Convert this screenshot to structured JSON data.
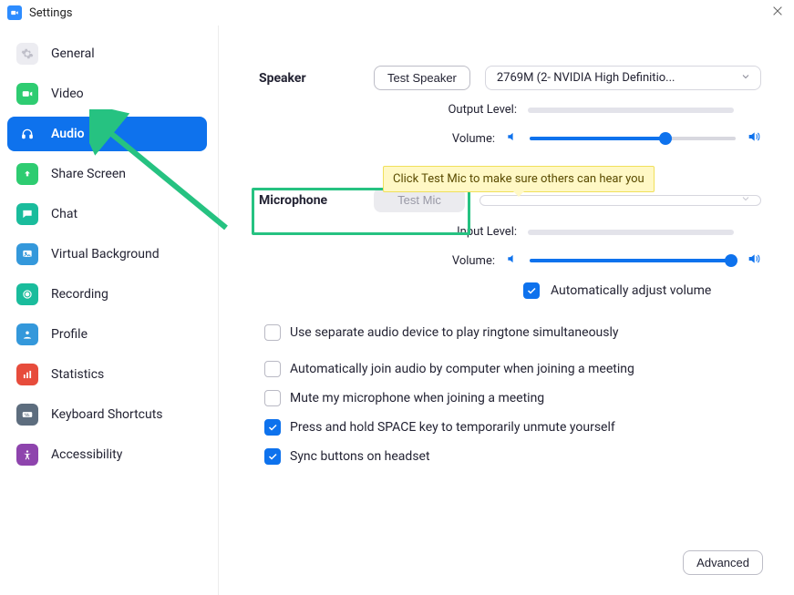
{
  "window": {
    "title": "Settings"
  },
  "sidebar": {
    "items": [
      {
        "label": "General"
      },
      {
        "label": "Video"
      },
      {
        "label": "Audio"
      },
      {
        "label": "Share Screen"
      },
      {
        "label": "Chat"
      },
      {
        "label": "Virtual Background"
      },
      {
        "label": "Recording"
      },
      {
        "label": "Profile"
      },
      {
        "label": "Statistics"
      },
      {
        "label": "Keyboard Shortcuts"
      },
      {
        "label": "Accessibility"
      }
    ],
    "active_index": 2
  },
  "speaker": {
    "section_label": "Speaker",
    "test_button": "Test Speaker",
    "device_selected": "2769M (2- NVIDIA High Definitio...",
    "output_level_label": "Output Level:",
    "volume_label": "Volume:",
    "volume_percent": 66
  },
  "microphone": {
    "section_label": "Microphone",
    "test_button": "Test Mic",
    "device_selected": "",
    "input_level_label": "Input Level:",
    "volume_label": "Volume:",
    "volume_percent": 98,
    "auto_adjust_label": "Automatically adjust volume",
    "auto_adjust_checked": true,
    "tooltip": "Click Test Mic to make sure others can hear you"
  },
  "options": {
    "separate_device": {
      "label": "Use separate audio device to play ringtone simultaneously",
      "checked": false
    },
    "auto_join": {
      "label": "Automatically join audio by computer when joining a meeting",
      "checked": false
    },
    "mute_on_join": {
      "label": "Mute my microphone when joining a meeting",
      "checked": false
    },
    "space_unmute": {
      "label": "Press and hold SPACE key to temporarily unmute yourself",
      "checked": true
    },
    "sync_headset": {
      "label": "Sync buttons on headset",
      "checked": true
    }
  },
  "advanced_button": "Advanced",
  "colors": {
    "primary": "#0E72ED",
    "tooltip_bg": "#FFF8C5",
    "highlight": "#26C281"
  }
}
